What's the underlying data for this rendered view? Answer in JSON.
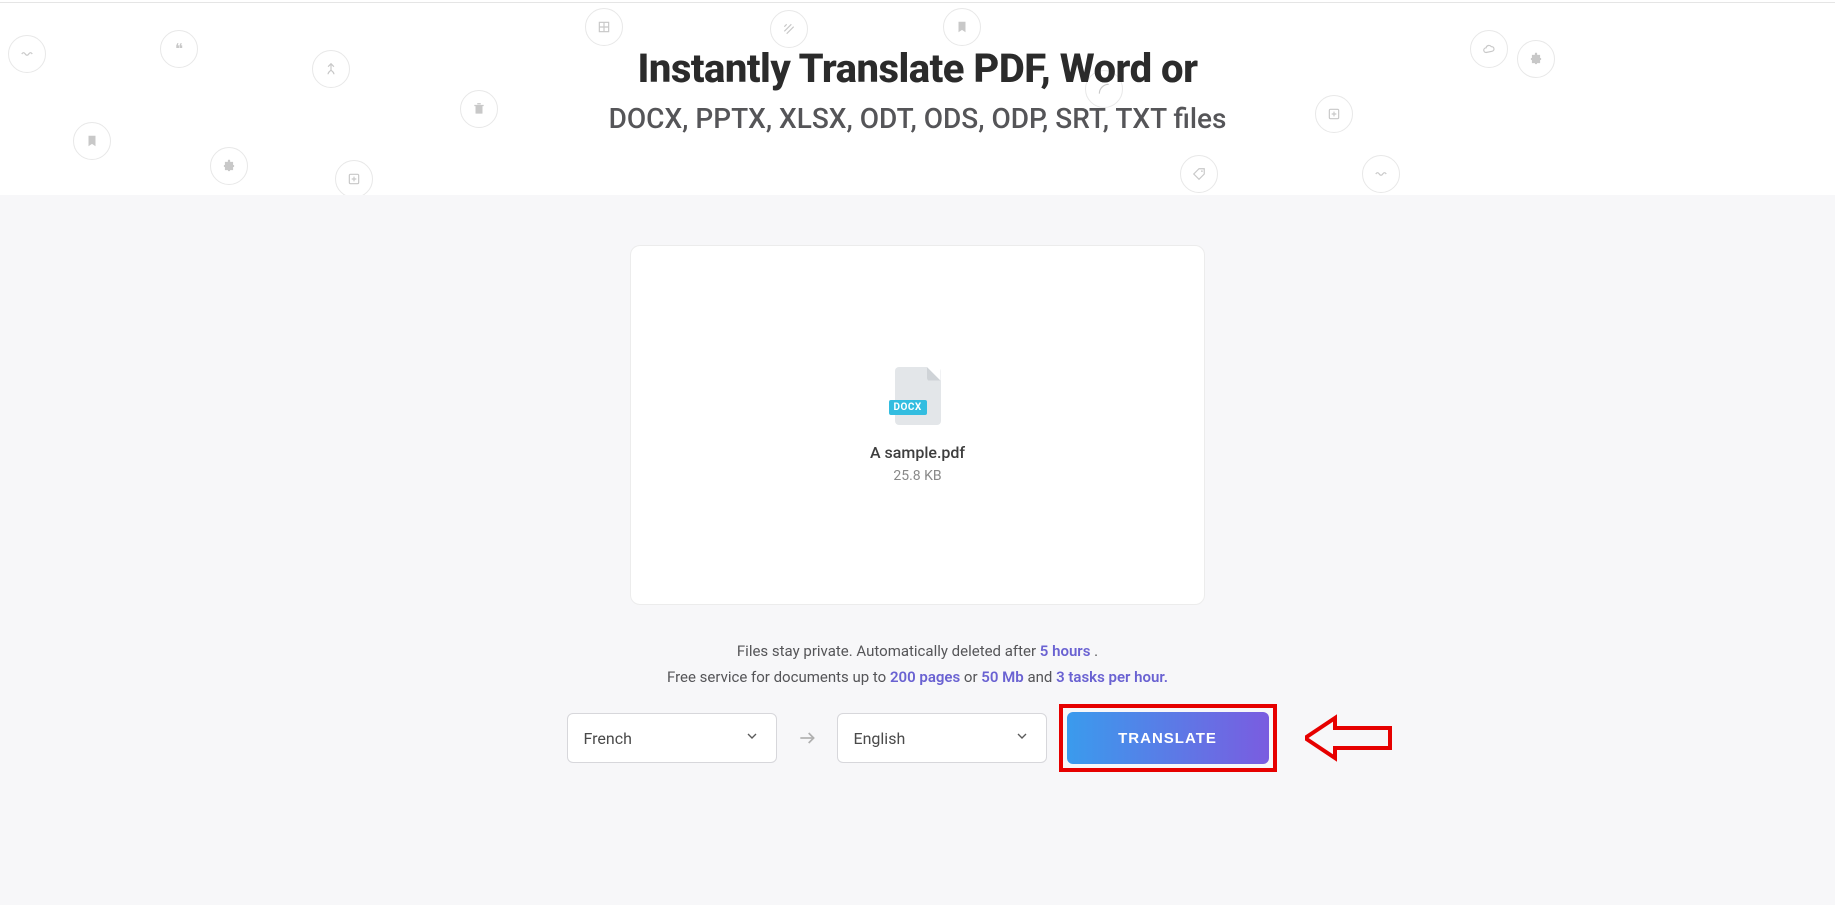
{
  "hero": {
    "title": "Instantly Translate PDF, Word or",
    "subtitle": "DOCX, PPTX, XLSX, ODT, ODS, ODP, SRT, TXT files"
  },
  "file": {
    "badge": "DOCX",
    "name": "A sample.pdf",
    "size": "25.8 KB"
  },
  "info": {
    "line1_pre": "Files stay private. Automatically deleted after ",
    "line1_hl": "5 hours",
    "line1_post": " .",
    "line2_pre": "Free service for documents up to ",
    "line2_hl1": "200 pages",
    "line2_mid1": " or ",
    "line2_hl2": "50 Mb",
    "line2_mid2": " and ",
    "line2_hl3": "3 tasks per hour.",
    "line2_post": ""
  },
  "languages": {
    "source": "French",
    "target": "English"
  },
  "buttons": {
    "translate": "TRANSLATE"
  }
}
